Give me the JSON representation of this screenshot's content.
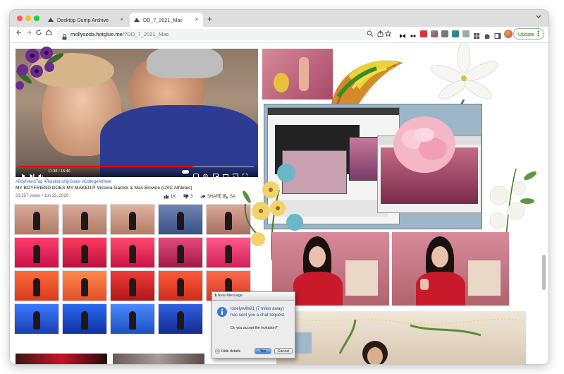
{
  "browser": {
    "tabs": [
      {
        "title": "Desktop Dump Archive"
      },
      {
        "title": "DD_7_2021_Mac"
      }
    ],
    "url_host": "mollysoda.hotglue.me",
    "url_path": "/?DD_7_2021_Mac",
    "update_label": "Update",
    "new_tab_label": "+",
    "tab_close": "×",
    "colors": {
      "accent": "#1e7a1e",
      "tab_bar": "#dedede",
      "omnibox": "#f1f3f4"
    }
  },
  "youtube": {
    "time": "11:38 / 15:46",
    "tags": "#BoyfriendTag #RelationshipGoals #CollegeAthlete",
    "title": "MY BOYFRIEND DOES MY MAKEUP! Victoria Garrick & Max Browne (USC Athletes)",
    "views": "23,257 views • Jun 25, 2020",
    "likes": "1K",
    "dislikes": "3",
    "share": "SHARE",
    "save": "SA"
  },
  "dialog": {
    "window_title": "1 New Message",
    "sender": "lonelywife81 (7 miles away)",
    "message": "has sent you a chat request.",
    "question": "Do you accept the invitation?",
    "hide_details": "Hide details",
    "yes": "Yes",
    "cancel": "Cancel"
  }
}
